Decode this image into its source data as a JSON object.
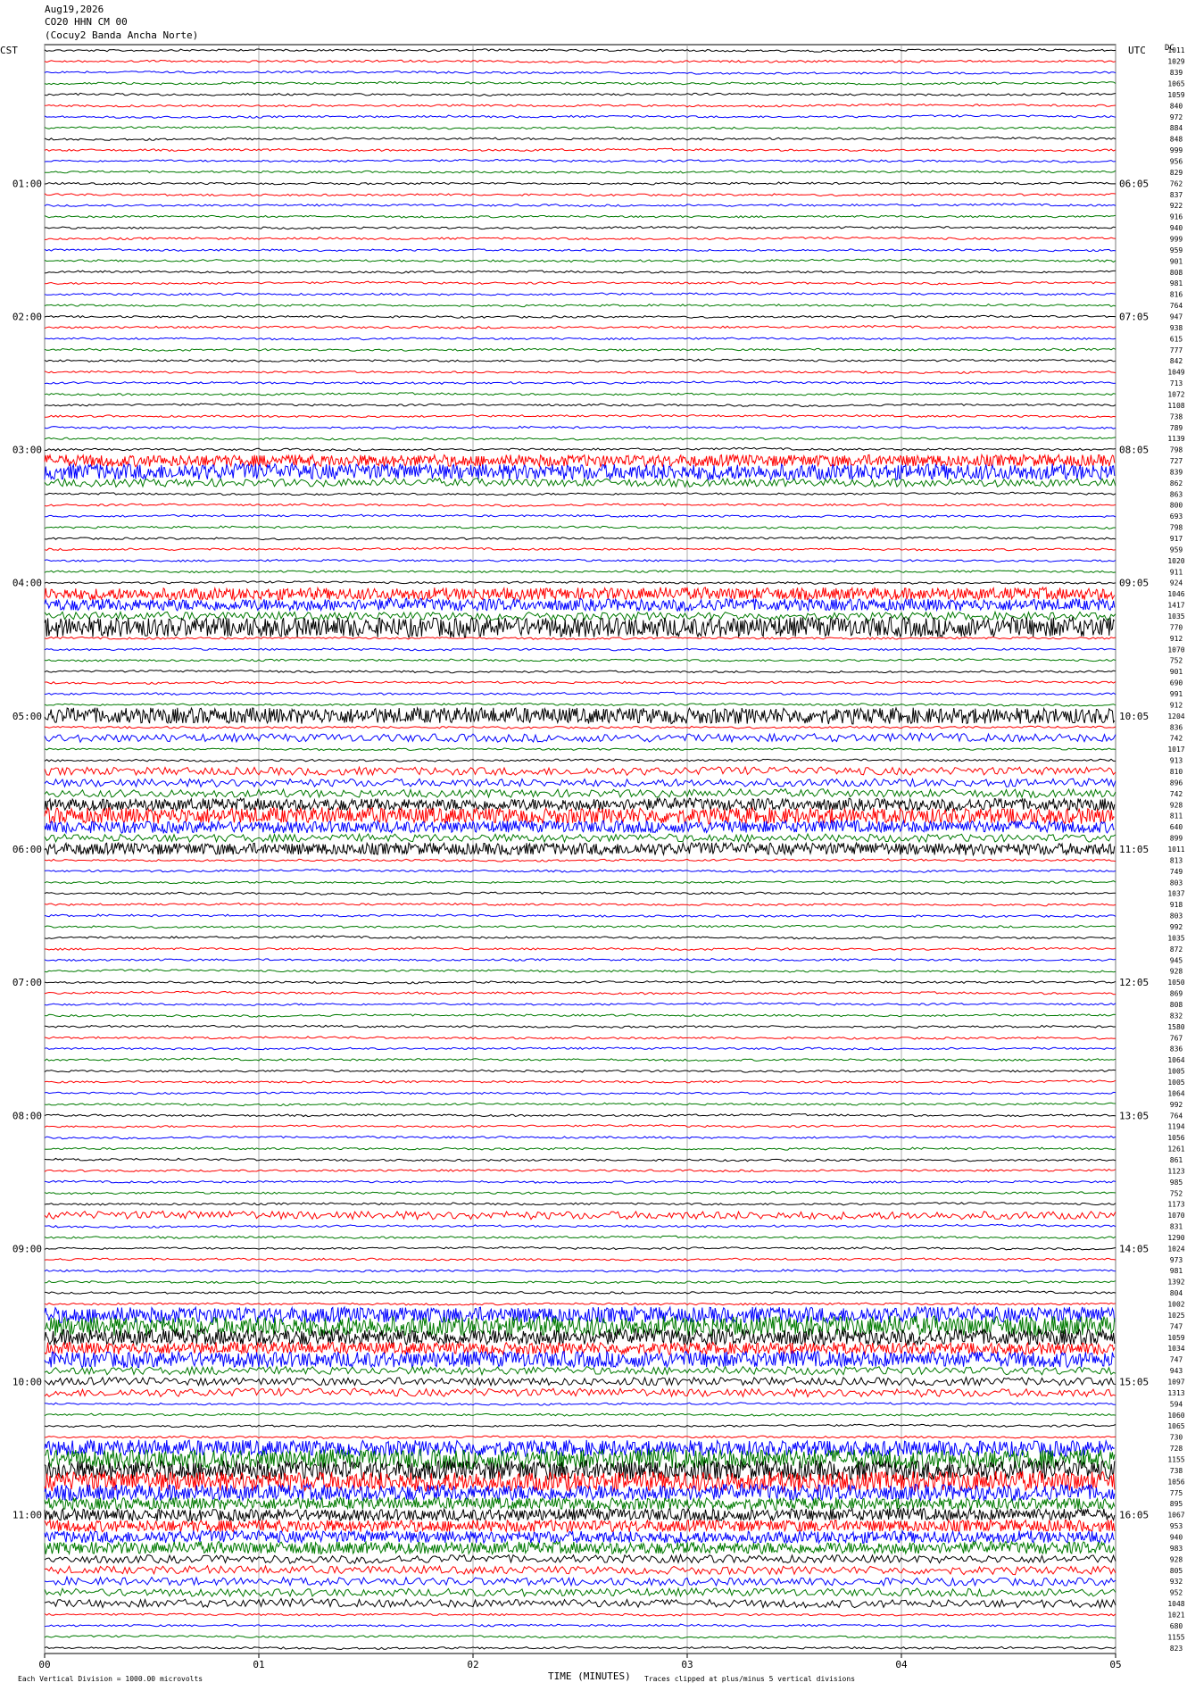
{
  "header": {
    "date": "Aug19,2026",
    "station": "CO20 HHN CM 00",
    "location": "(Cocuy2 Banda Ancha Norte)"
  },
  "left_tz": "CST",
  "right_tz": "UTC",
  "footer": {
    "scale_note": "Each Vertical Division = 1000.00 microvolts",
    "xlabel": "TIME (MINUTES)",
    "clip_note": "Traces clipped at plus/minus 5 vertical divisions"
  },
  "chart_data": {
    "type": "line",
    "description_kind": "helicorder",
    "xlabel": "TIME (MINUTES)",
    "xlim": [
      0,
      5
    ],
    "x_ticks": [
      "00",
      "01",
      "02",
      "03",
      "04",
      "05"
    ],
    "left_hour_labels": [
      "01:00",
      "02:00",
      "03:00",
      "04:00",
      "05:00",
      "06:00",
      "07:00",
      "08:00",
      "09:00",
      "10:00",
      "11:00"
    ],
    "right_hour_labels": [
      "06:05",
      "07:05",
      "08:05",
      "09:05",
      "10:05",
      "11:05",
      "12:05",
      "13:05",
      "14:05",
      "15:05",
      "16:05"
    ],
    "rows_per_hour": 12,
    "trace_colors": [
      "#000000",
      "#ff0000",
      "#0000ff",
      "#007a00"
    ],
    "row_values_header": "DC",
    "row_values": [
      1011,
      1029,
      839,
      1065,
      1059,
      840,
      972,
      884,
      848,
      999,
      956,
      829,
      762,
      837,
      922,
      916,
      940,
      999,
      959,
      901,
      808,
      981,
      816,
      764,
      947,
      938,
      615,
      777,
      842,
      1049,
      713,
      1072,
      1108,
      738,
      789,
      1139,
      798,
      727,
      839,
      862,
      863,
      800,
      693,
      798,
      917,
      959,
      1020,
      911,
      924,
      1046,
      1417,
      1035,
      770,
      912,
      1070,
      752,
      901,
      690,
      991,
      912,
      1204,
      836,
      742,
      1017,
      913,
      810,
      896,
      742,
      928,
      811,
      640,
      899,
      1011,
      813,
      749,
      803,
      1037,
      918,
      803,
      992,
      1035,
      872,
      945,
      928,
      1050,
      869,
      808,
      832,
      1580,
      767,
      836,
      1064,
      1005,
      1005,
      1064,
      992,
      764,
      1194,
      1056,
      1261,
      861,
      1123,
      985,
      752,
      1173,
      1070,
      831,
      1290,
      1024,
      973,
      981,
      1392,
      804,
      1002,
      1025,
      747,
      1059,
      1034,
      747,
      943,
      1097,
      1313,
      594,
      1060,
      1065,
      730,
      728,
      1155,
      738,
      1056,
      775,
      895,
      1067,
      953,
      940,
      983,
      928,
      805,
      932,
      952,
      1048,
      1021,
      680,
      1155,
      823
    ],
    "amplitudes": [
      1,
      1,
      1,
      1,
      1,
      1,
      1,
      1,
      1,
      1,
      1,
      1,
      1,
      1,
      1,
      1,
      1,
      1,
      1,
      1,
      1,
      1,
      1,
      1,
      1,
      1,
      1,
      1,
      1,
      1,
      1,
      1,
      1,
      1,
      1,
      1,
      1,
      3,
      4,
      2,
      1,
      1,
      1,
      1,
      1,
      1,
      1,
      1,
      1,
      3,
      3,
      2,
      5,
      1,
      1,
      1,
      1,
      1,
      1,
      1,
      4,
      1,
      2,
      1,
      1,
      2,
      2,
      2,
      3,
      4,
      3,
      2,
      3,
      1,
      1,
      1,
      1,
      1,
      1,
      1,
      1,
      1,
      1,
      1,
      1,
      1,
      1,
      1,
      1,
      1,
      1,
      1,
      1,
      1,
      1,
      1,
      1,
      1,
      1,
      1,
      1,
      1,
      1,
      1,
      1,
      2,
      1,
      1,
      1,
      1,
      1,
      1,
      1,
      1,
      4,
      5,
      4,
      3,
      4,
      2,
      2,
      2,
      1,
      1,
      1,
      1,
      4,
      5,
      5,
      5,
      4,
      3,
      3,
      3,
      3,
      3,
      2,
      2,
      2,
      2,
      2,
      1,
      1,
      1
    ]
  }
}
